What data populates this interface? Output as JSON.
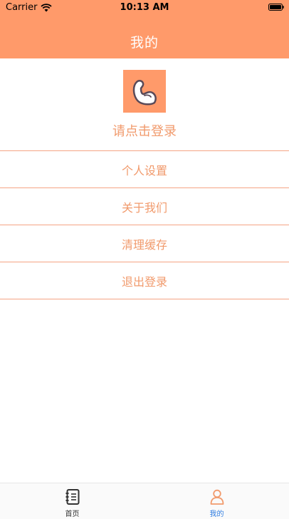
{
  "status_bar": {
    "carrier": "Carrier",
    "time": "10:13 AM"
  },
  "nav": {
    "title": "我的"
  },
  "profile": {
    "avatar_icon": "flexed-arm-icon",
    "login_prompt": "请点击登录"
  },
  "menu": {
    "items": [
      {
        "label": "个人设置"
      },
      {
        "label": "关于我们"
      },
      {
        "label": "清理缓存"
      },
      {
        "label": "退出登录"
      }
    ]
  },
  "tabbar": {
    "tabs": [
      {
        "label": "首页",
        "icon": "notebook-icon",
        "active": false
      },
      {
        "label": "我的",
        "icon": "person-icon",
        "active": true
      }
    ]
  },
  "colors": {
    "accent": "#ff9a6a",
    "menu_text": "#f19a6c",
    "tab_active": "#2f7de1",
    "tab_inactive": "#333333"
  }
}
